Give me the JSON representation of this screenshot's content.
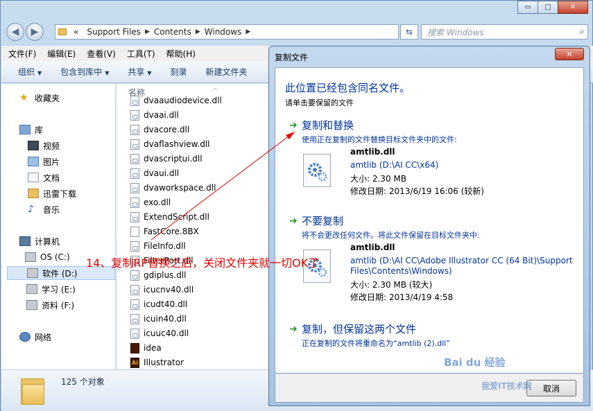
{
  "explorer": {
    "caption_buttons": [
      "▭",
      "□",
      "✕"
    ],
    "breadcrumb": [
      "«",
      "Support Files",
      "Contents",
      "Windows"
    ],
    "search_placeholder": "搜索 Windows",
    "menu": [
      "文件(F)",
      "编辑(E)",
      "查看(V)",
      "工具(T)",
      "帮助(H)"
    ],
    "commands": [
      {
        "label": "组织",
        "dropdown": true
      },
      {
        "label": "包含到库中",
        "dropdown": true
      },
      {
        "label": "共享",
        "dropdown": true
      },
      {
        "label": "刻录",
        "dropdown": false
      },
      {
        "label": "新建文件夹",
        "dropdown": false
      }
    ],
    "nav": {
      "favorites": "收藏夹",
      "libraries": "库",
      "library_items": [
        "视频",
        "图片",
        "文档",
        "迅雷下载",
        "音乐"
      ],
      "computer": "计算机",
      "drives": [
        "OS (C:)",
        "软件 (D:)",
        "学习 (E:)",
        "资料 (F:)"
      ],
      "network": "网络"
    },
    "column_header": "名称",
    "files": [
      "dvaaudiodevice.dll",
      "dvaai.dll",
      "dvacore.dll",
      "dvaflashview.dll",
      "dvascriptui.dll",
      "dvaui.dll",
      "dvaworkspace.dll",
      "exo.dll",
      "ExtendScript.dll",
      "FastCore.8BX",
      "FileInfo.dll",
      "FilterPort.dll",
      "gdiplus.dll",
      "icucnv40.dll",
      "icudt40.dll",
      "icuin40.dll",
      "icuuc40.dll",
      "idea",
      "Illustrator"
    ],
    "status_count": "125 个对象"
  },
  "dialog": {
    "title": "复制文件",
    "close": "✕",
    "heading": "此位置已经包含同名文件。",
    "subheading": "请单击要保留的文件",
    "option_replace": {
      "title": "复制和替换",
      "desc": "使用正在复制的文件替换目标文件夹中的文件:",
      "file_name": "amtlib.dll",
      "file_path": "amtlib (D:\\AI  CC\\x64)",
      "size": "大小: 2.30 MB",
      "modified": "修改日期: 2013/6/19 16:06 (较新)"
    },
    "option_skip": {
      "title": "不要复制",
      "desc": "将不会更改任何文件。将此文件保留在目标文件夹中:",
      "file_name": "amtlib.dll",
      "file_path": "amtlib (D:\\AI  CC\\Adobe Illustrator CC (64 Bit)\\Support",
      "file_path2": "Files\\Contents\\Windows)",
      "size": "大小: 2.30 MB (较大)",
      "modified": "修改日期: 2013/4/19 4:58"
    },
    "option_keep_both": {
      "title": "复制，但保留这两个文件",
      "desc": "正在复制的文件将重命名为“amtlib (2).dll”"
    },
    "cancel": "取消"
  },
  "annotation": "14、复制RP替换之后，关闭文件夹就一切OK了",
  "watermark": "Bai du 经验",
  "watermark2": "我爱IT技术网"
}
